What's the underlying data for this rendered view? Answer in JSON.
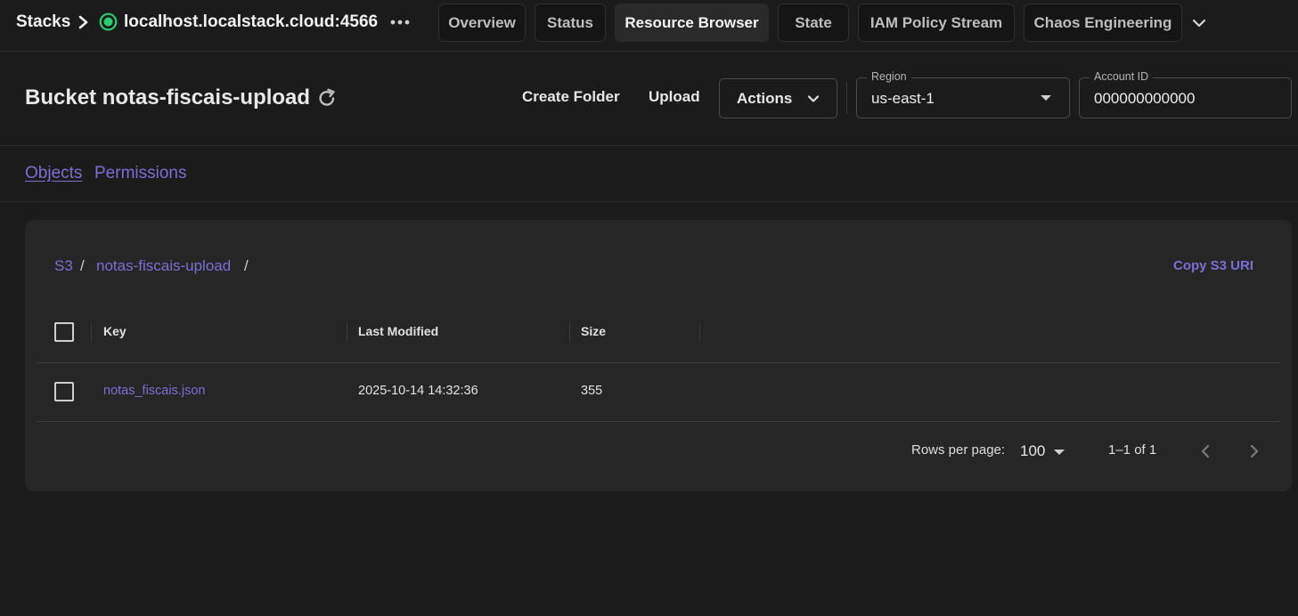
{
  "topbar": {
    "stacks_label": "Stacks",
    "host": "localhost.localstack.cloud:4566",
    "status_color": "#2ecc71",
    "tabs": [
      {
        "label": "Overview"
      },
      {
        "label": "Status"
      },
      {
        "label": "Resource Browser",
        "active": true
      },
      {
        "label": "State"
      },
      {
        "label": "IAM Policy Stream"
      },
      {
        "label": "Chaos Engineering"
      }
    ]
  },
  "header": {
    "title": "Bucket notas-fiscais-upload",
    "create_folder": "Create Folder",
    "upload": "Upload",
    "actions": "Actions",
    "region_label": "Region",
    "region_value": "us-east-1",
    "account_label": "Account ID",
    "account_value": "000000000000"
  },
  "subtabs": {
    "objects": "Objects",
    "permissions": "Permissions"
  },
  "breadcrumb": {
    "root": "S3",
    "sep": "/",
    "bucket": "notas-fiscais-upload",
    "trail": "/"
  },
  "copy_uri": "Copy S3 URI",
  "table": {
    "columns": {
      "key": "Key",
      "modified": "Last Modified",
      "size": "Size"
    },
    "rows": [
      {
        "key": "notas_fiscais.json",
        "modified": "2025-10-14 14:32:36",
        "size": "355"
      }
    ]
  },
  "pagination": {
    "rows_label": "Rows per page:",
    "rows_value": "100",
    "range": "1–1 of 1"
  },
  "colors": {
    "accent": "#7b6fd6",
    "background": "#1b1b1b",
    "panel": "#262626"
  }
}
